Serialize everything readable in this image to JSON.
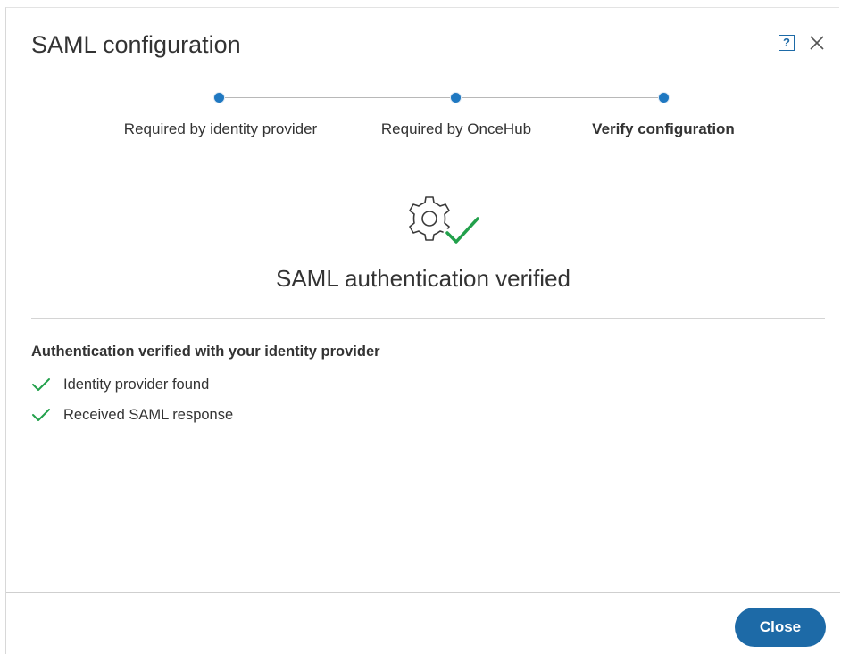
{
  "dialog": {
    "title": "SAML configuration",
    "help_label": "?",
    "close_button_label": "Close"
  },
  "stepper": {
    "steps": [
      {
        "label": "Required by identity provider",
        "state": "complete"
      },
      {
        "label": "Required by OnceHub",
        "state": "complete"
      },
      {
        "label": "Verify configuration",
        "state": "active"
      }
    ],
    "accent_color": "#1f78c1"
  },
  "result": {
    "icon": "gear-check-icon",
    "heading": "SAML authentication verified",
    "success_color": "#22a04b"
  },
  "details": {
    "title": "Authentication verified with your identity provider",
    "items": [
      {
        "icon": "check-icon",
        "label": "Identity provider found"
      },
      {
        "icon": "check-icon",
        "label": "Received SAML response"
      }
    ]
  }
}
